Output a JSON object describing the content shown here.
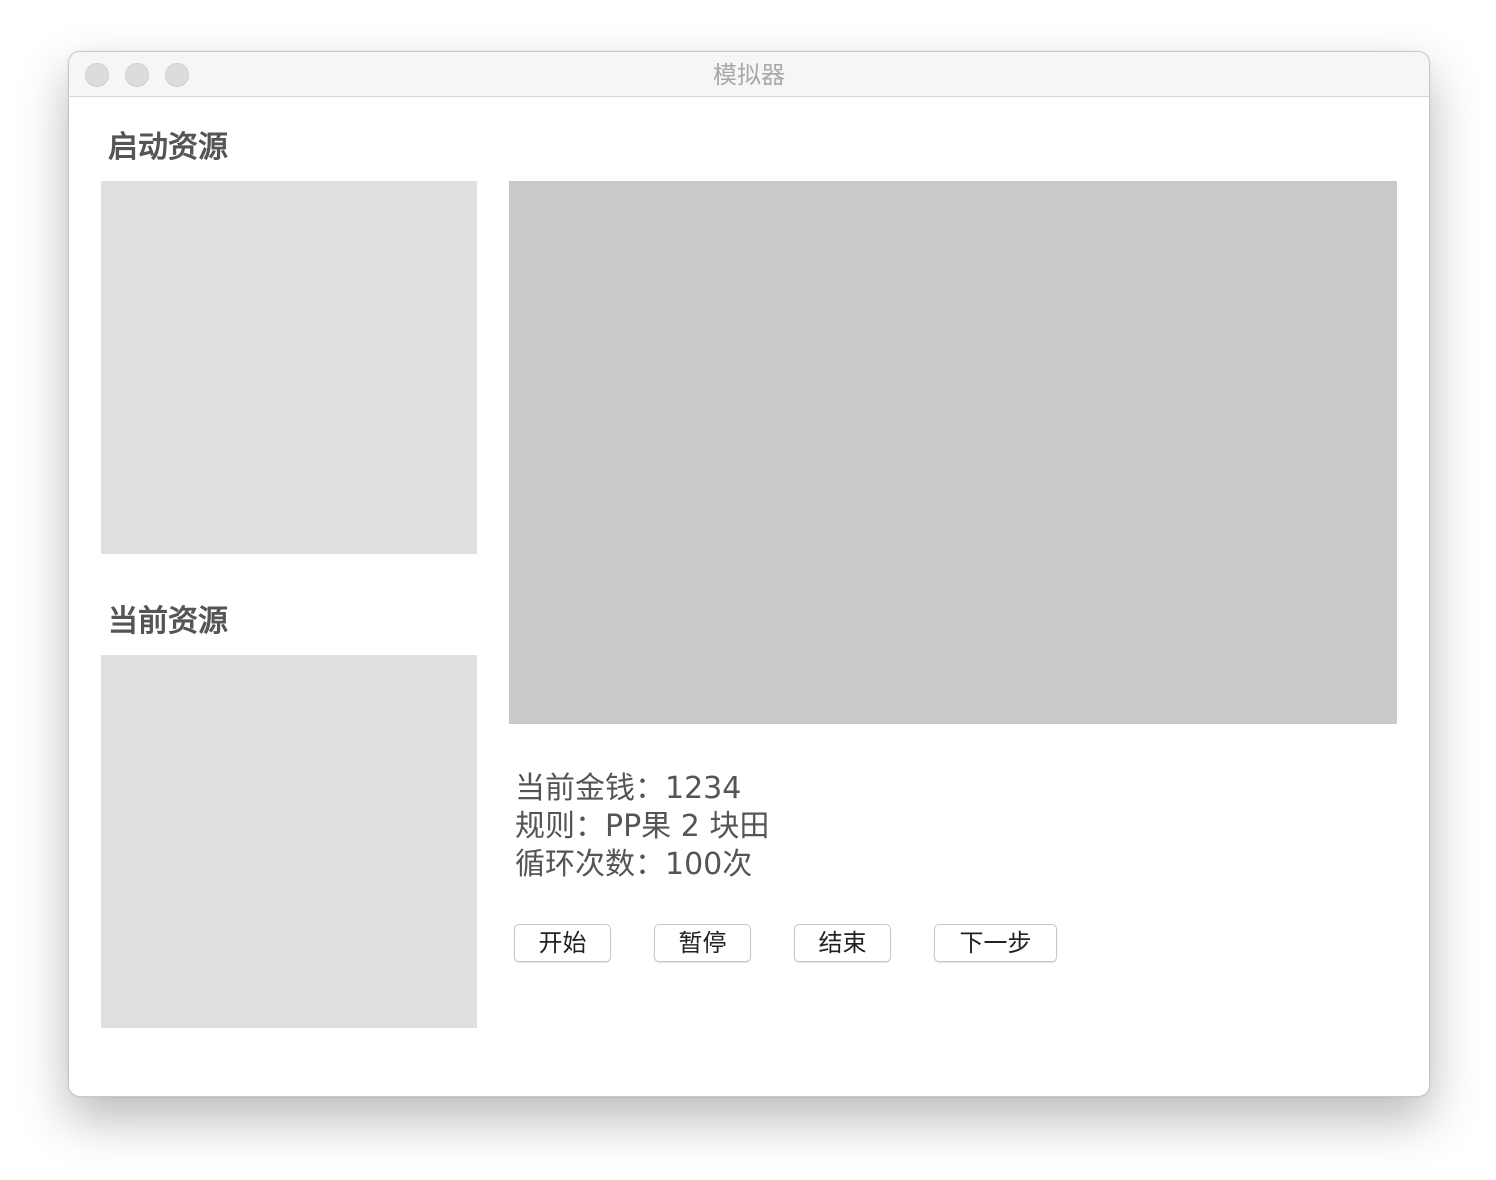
{
  "window": {
    "title": "模拟器"
  },
  "sections": {
    "start_resources_title": "启动资源",
    "current_resources_title": "当前资源"
  },
  "info": {
    "money": "当前金钱：1234",
    "rule": "规则：PP果 2 块田",
    "loops": "循环次数：100次"
  },
  "buttons": {
    "start": "开始",
    "pause": "暂停",
    "end": "结束",
    "next": "下一步"
  },
  "colors": {
    "side_panel": "#e0e0e0",
    "main_panel": "#cacaca",
    "text": "#555555"
  }
}
